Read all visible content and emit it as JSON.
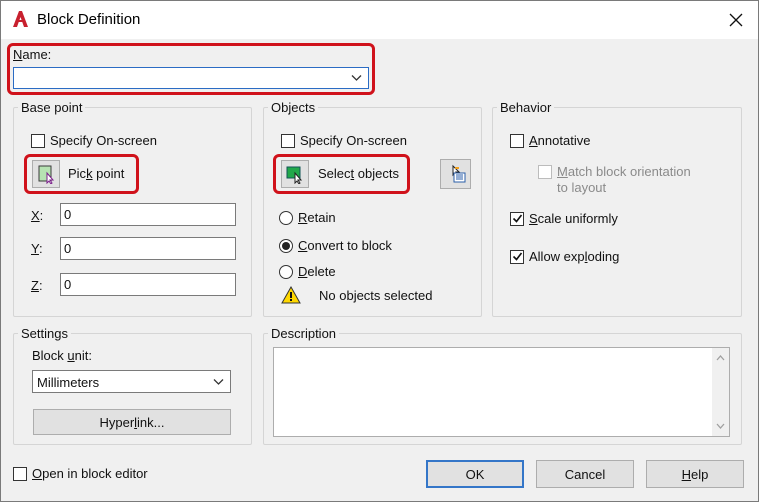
{
  "window": {
    "title": "Block Definition",
    "app_icon": "autocad-a-icon",
    "close_icon": "close-icon"
  },
  "name": {
    "label_u": "N",
    "label_rest": "ame:",
    "value": ""
  },
  "base_point": {
    "title": "Base point",
    "specify_onscreen": "Specify On-screen",
    "pick_point_pre": "Pic",
    "pick_point_u": "k",
    "pick_point_post": " point",
    "x_label": "X",
    "y_label": "Y",
    "z_label": "Z",
    "x_value": "0",
    "y_value": "0",
    "z_value": "0"
  },
  "objects": {
    "title": "Objects",
    "specify_onscreen": "Specify On-screen",
    "select_objects_pre": "Selec",
    "select_objects_u": "t",
    "select_objects_post": " objects",
    "retain_u": "R",
    "retain_rest": "etain",
    "convert_u": "C",
    "convert_rest": "onvert to block",
    "delete_u": "D",
    "delete_rest": "elete",
    "status": "No objects selected",
    "selected_option": "convert"
  },
  "behavior": {
    "title": "Behavior",
    "annotative_u": "A",
    "annotative_rest": "nnotative",
    "match_u": "M",
    "match_rest": "atch block orientation",
    "match_line2": "to layout",
    "scale_u": "S",
    "scale_rest": "cale uniformly",
    "allow_pre": "Allow exp",
    "allow_u": "l",
    "allow_post": "oding",
    "annotative_checked": false,
    "scale_checked": true,
    "allow_checked": true
  },
  "settings": {
    "title": "Settings",
    "block_unit_pre": "Block ",
    "block_unit_u": "u",
    "block_unit_post": "nit:",
    "unit_value": "Millimeters",
    "hyperlink_pre": "Hyper",
    "hyperlink_u": "l",
    "hyperlink_post": "ink..."
  },
  "description": {
    "title": "Description",
    "value": ""
  },
  "footer": {
    "open_editor_u": "O",
    "open_editor_rest": "pen in block editor",
    "ok": "OK",
    "cancel": "Cancel",
    "help_u": "H",
    "help_rest": "elp"
  },
  "colors": {
    "highlight": "#d0121b",
    "default_button_border": "#3476c8",
    "app_icon": "#c8202e"
  }
}
